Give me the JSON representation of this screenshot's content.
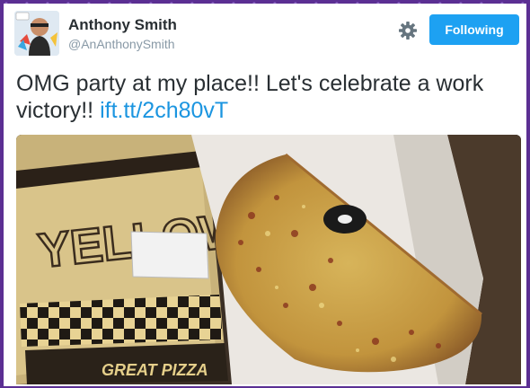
{
  "tweet": {
    "author_name": "Anthony Smith",
    "author_handle": "@AnAnthonySmith",
    "text": "OMG party at my place!! Let's celebrate a work victory!! ",
    "link_text": "ift.tt/2ch80vT"
  },
  "actions": {
    "follow_label": "Following",
    "settings_icon": "gear-icon"
  },
  "media": {
    "box_brand": "YELLOW",
    "box_slogan": "GREAT PIZZA"
  },
  "colors": {
    "accent": "#1da1f2",
    "link": "#1b95e0",
    "background": "#5b2f93"
  }
}
